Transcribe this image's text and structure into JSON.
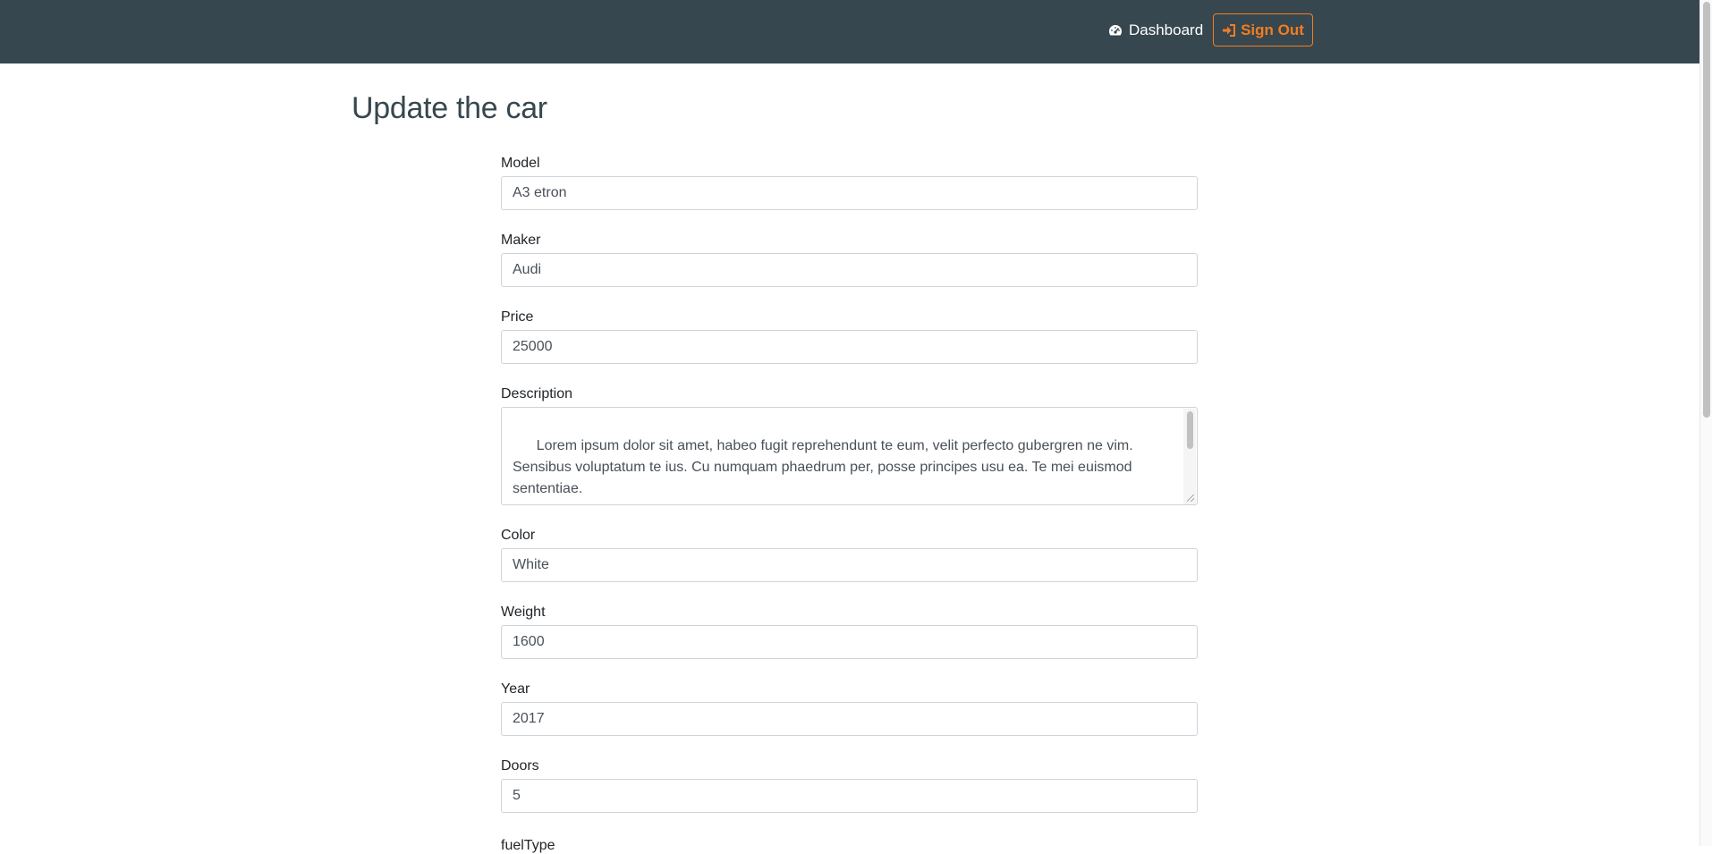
{
  "nav": {
    "dashboard_label": "Dashboard",
    "signout_label": "Sign Out",
    "bg_color": "#37474f",
    "accent_color": "#f47c20"
  },
  "page_title": "Update the car",
  "form": {
    "model": {
      "label": "Model",
      "value": "A3 etron"
    },
    "maker": {
      "label": "Maker",
      "value": "Audi"
    },
    "price": {
      "label": "Price",
      "value": "25000"
    },
    "description": {
      "label": "Description",
      "value": "Lorem ipsum dolor sit amet, habeo fugit reprehendunt te eum, velit perfecto gubergren ne vim. Sensibus voluptatum te ius. Cu numquam phaedrum per, posse principes usu ea. Te mei euismod sententiae."
    },
    "color": {
      "label": "Color",
      "value": "White"
    },
    "weight": {
      "label": "Weight",
      "value": "1600"
    },
    "year": {
      "label": "Year",
      "value": "2017"
    },
    "doors": {
      "label": "Doors",
      "value": "5"
    },
    "fuel_type": {
      "label": "fuelType"
    }
  }
}
